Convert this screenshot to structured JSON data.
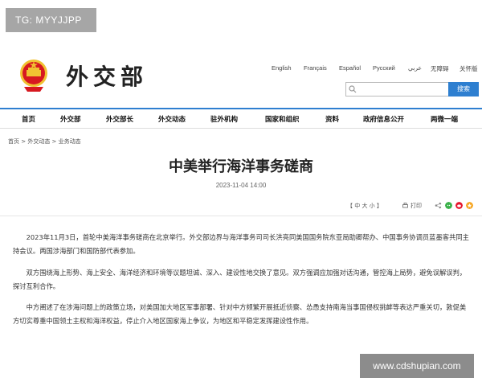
{
  "watermark_top": "TG: MYYJJPP",
  "header": {
    "logo_text": "外交部",
    "languages": [
      "English",
      "Français",
      "Español",
      "Русский",
      "عربي",
      "无障碍",
      "关怀版"
    ],
    "search_placeholder": "",
    "search_button": "搜索"
  },
  "nav": {
    "items": [
      "首页",
      "外交部",
      "外交部长",
      "外交动态",
      "驻外机构",
      "国家和组织",
      "资料",
      "政府信息公开",
      "两微一端"
    ]
  },
  "breadcrumb": "首页 > 外交动态 > 业务动态",
  "article": {
    "title": "中美举行海洋事务磋商",
    "date": "2023-11-04 14:00",
    "font_size_label": "【 中  大  小 】",
    "print_label": "打印",
    "paragraphs": [
      "2023年11月3日，首轮中美海洋事务磋商在北京举行。外交部边界与海洋事务司司长洪亮同美国国务院东亚局助卿帮办、中国事务协调员蓝墨客共同主持会议。两国涉海部门和国防部代表参加。",
      "双方围绕海上形势、海上安全、海洋经济和环境等议题坦诚、深入、建设性地交换了意见。双方强调应加强对话沟通，管控海上局势，避免误解误判，探讨互利合作。",
      "中方阐述了在涉海问题上的政策立场，对美国加大地区军事部署、针对中方频繁开展抵近侦察、怂恿支持南海当事国侵权挑衅等表达严重关切，敦促美方切实尊重中国领土主权和海洋权益，停止介入地区国家海上争议，为地区和平稳定发挥建设性作用。"
    ]
  },
  "watermark_bottom": "www.cdshupian.com",
  "colors": {
    "accent": "#2e7fd0",
    "emblem_red": "#d71920",
    "emblem_gold": "#f1c232"
  }
}
